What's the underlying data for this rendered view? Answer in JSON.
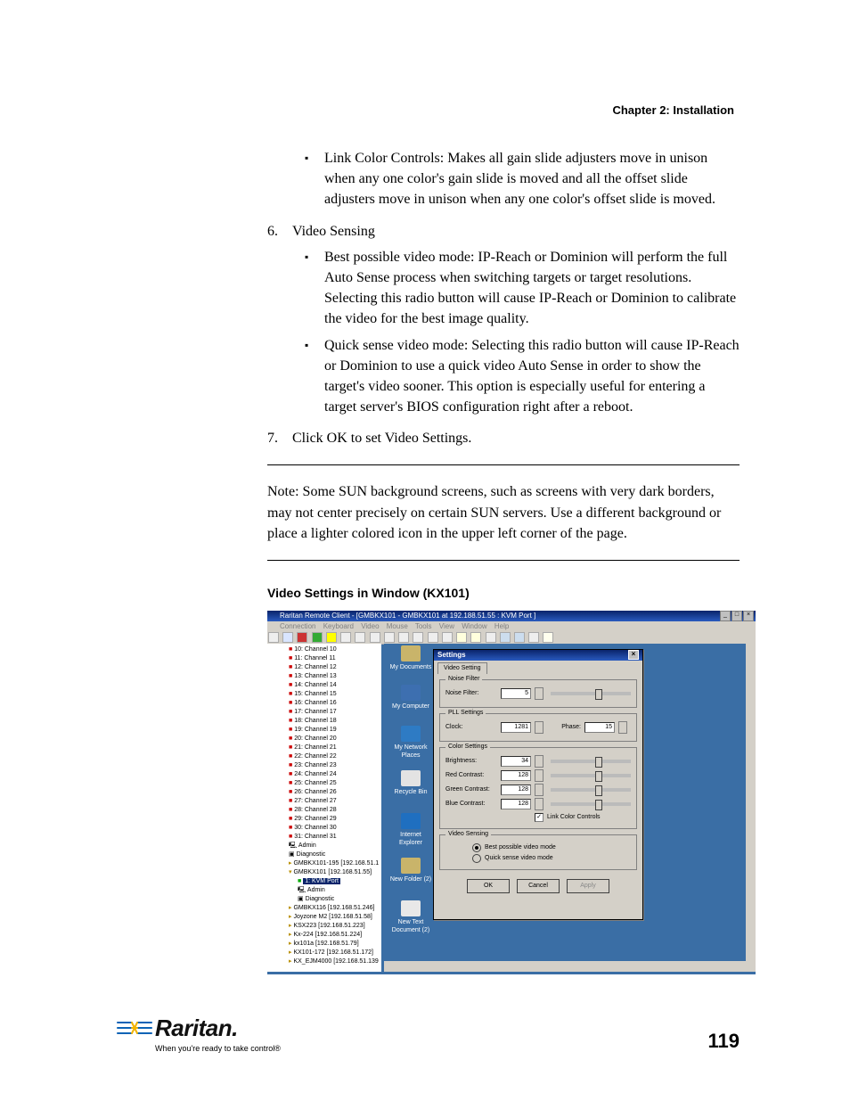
{
  "header": {
    "chapter": "Chapter 2: Installation"
  },
  "b1": "Link Color Controls: Makes all gain slide adjusters move in unison when any one color's gain slide is moved and all the offset slide adjusters move in unison when any one color's offset slide is moved.",
  "n6_num": "6.",
  "n6_text": "Video Sensing",
  "b2": "Best possible video mode: IP-Reach or Dominion will perform the full Auto Sense process when switching targets or target resolutions. Selecting this radio button will cause IP-Reach or Dominion to calibrate the video for the best image quality.",
  "b3": "Quick sense video mode: Selecting this radio button will cause IP-Reach or Dominion to use a quick video Auto Sense in order to show the target's video sooner. This option is especially useful for entering a target server's BIOS configuration right after a reboot.",
  "n7_num": "7.",
  "n7_text": "Click OK to set Video Settings.",
  "note": "Note: Some SUN background screens, such as screens with very dark borders, may not center precisely on certain SUN servers. Use a different background or place a lighter colored icon in the upper left corner of the page.",
  "subhead": "Video Settings in Window (KX101)",
  "shot": {
    "title": "Raritan Remote Client - [GMBKX101 - GMBKX101 at 192.188.51.55 : KVM Port ]",
    "menu": [
      "Connection",
      "Keyboard",
      "Video",
      "Mouse",
      "Tools",
      "View",
      "Window",
      "Help"
    ],
    "tree": [
      "10: Channel 10",
      "11: Channel 11",
      "12: Channel 12",
      "13: Channel 13",
      "14: Channel 14",
      "15: Channel 15",
      "16: Channel 16",
      "17: Channel 17",
      "18: Channel 18",
      "19: Channel 19",
      "20: Channel 20",
      "21: Channel 21",
      "22: Channel 22",
      "23: Channel 23",
      "24: Channel 24",
      "25: Channel 25",
      "26: Channel 26",
      "27: Channel 27",
      "28: Channel 28",
      "29: Channel 29",
      "30: Channel 30",
      "31: Channel 31"
    ],
    "tree_admin": "Admin",
    "tree_diag": "Diagnostic",
    "tree_devs": [
      "GMBKX101-195 [192.168.51.1",
      "GMBKX101 [192.168.51.55]",
      "1: KVM Port",
      "Admin",
      "Diagnostic",
      "GMBKX116 [192.168.51.246]",
      "Joyzone M2 [192.168.51.58]",
      "KSX223 [192.168.51.223]",
      "Kx-224 [192.168.51.224]",
      "kx101a [192.168.51.79]",
      "KX101-172 [192.168.51.172]",
      "KX_EJM4000 [192.168.51.139"
    ],
    "desk": [
      {
        "label": "My Documents",
        "fill": "#c9b46a"
      },
      {
        "label": "My Computer",
        "fill": "#3d6fb0"
      },
      {
        "label": "My Network Places",
        "fill": "#2e7bc4"
      },
      {
        "label": "Recycle Bin",
        "fill": "#e3e3e3"
      },
      {
        "label": "Internet Explorer",
        "fill": "#1f6fc0"
      },
      {
        "label": "New Folder (2)",
        "fill": "#c9b46a"
      },
      {
        "label": "New Text Document (2)",
        "fill": "#e8e8e8"
      }
    ],
    "dialog": {
      "title": "Settings",
      "tab": "Video Setting",
      "grpNoise": {
        "legend": "Noise Filter",
        "label": "Noise Filter:",
        "value": "5"
      },
      "grpPLL": {
        "legend": "PLL Settings",
        "clock_label": "Clock:",
        "clock_value": "1281",
        "phase_label": "Phase:",
        "phase_value": "15"
      },
      "grpColor": {
        "legend": "Color Settings",
        "rows": [
          {
            "label": "Brightness:",
            "value": "34"
          },
          {
            "label": "Red Contrast:",
            "value": "128"
          },
          {
            "label": "Green Contrast:",
            "value": "128"
          },
          {
            "label": "Blue Contrast:",
            "value": "128"
          }
        ],
        "link_label": "Link Color Controls",
        "link_checked": true
      },
      "grpSense": {
        "legend": "Video Sensing",
        "best": "Best possible video mode",
        "quick": "Quick sense video mode"
      },
      "ok": "OK",
      "cancel": "Cancel",
      "apply": "Apply"
    }
  },
  "footer": {
    "brand": "Raritan.",
    "tag": "When you're ready to take control®",
    "page": "119"
  }
}
